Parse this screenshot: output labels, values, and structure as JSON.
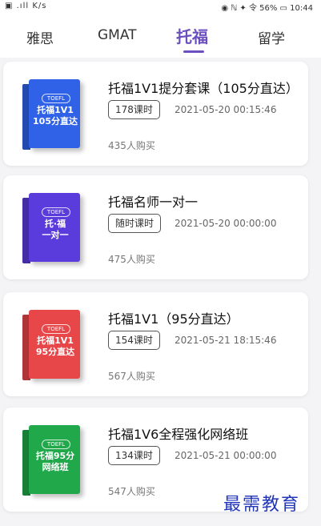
{
  "status_bar": {
    "left": "▣ .ıll K/s",
    "right": "◉ ℕ ✦ 令 56% ▭ 10:44"
  },
  "tabs": [
    {
      "label": "雅思",
      "active": false
    },
    {
      "label": "GMAT",
      "active": false
    },
    {
      "label": "托福",
      "active": true
    },
    {
      "label": "留学",
      "active": false
    }
  ],
  "courses": [
    {
      "title": "托福1V1提分套课（105分直达）",
      "hours": "178课时",
      "date": "2021-05-20 00:15:46",
      "buyers": "435人购买",
      "cover": {
        "badge": "TOEFL",
        "text": "托福1V1\n105分直达",
        "color": "#2f62e6"
      }
    },
    {
      "title": "托福名师一对一",
      "hours": "随时课时",
      "date": "2021-05-20 00:00:00",
      "buyers": "475人购买",
      "cover": {
        "badge": "TOEFL",
        "text": "托·福\n一对一",
        "color": "#5a3bdc"
      }
    },
    {
      "title": "托福1V1（95分直达）",
      "hours": "154课时",
      "date": "2021-05-21 18:15:46",
      "buyers": "567人购买",
      "cover": {
        "badge": "TOEFL",
        "text": "托福1V1\n95分直达",
        "color": "#e8474a"
      }
    },
    {
      "title": "托福1V6全程强化网络班",
      "hours": "134课时",
      "date": "2021-05-21 00:00:00",
      "buyers": "547人购买",
      "cover": {
        "badge": "TOEFL",
        "text": "托福95分\n网络班",
        "color": "#21a84b"
      }
    }
  ],
  "watermark": "最需教育"
}
